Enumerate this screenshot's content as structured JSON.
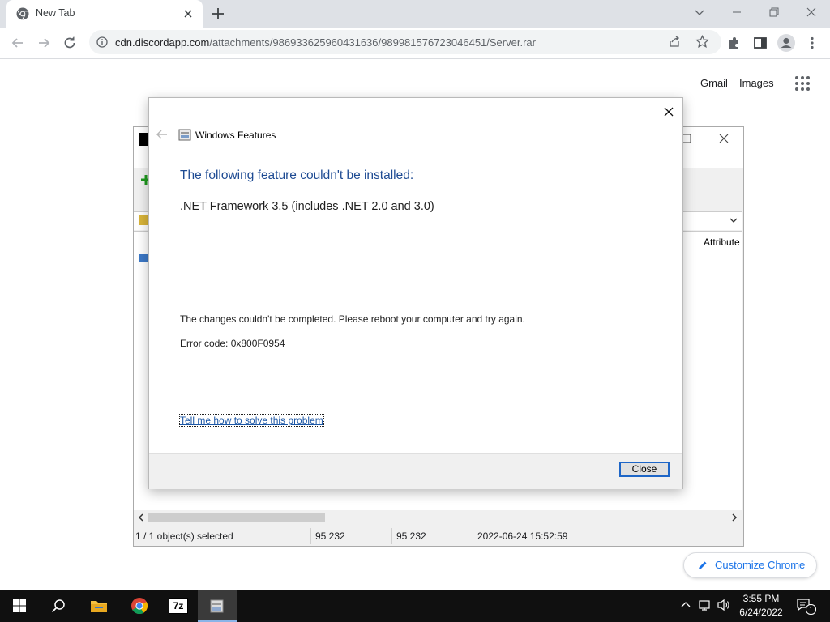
{
  "browser": {
    "tab_title": "New Tab",
    "url_host": "cdn.discordapp.com",
    "url_path": "/attachments/986933625960431636/989981576723046451/Server.rar"
  },
  "ntp": {
    "gmail": "Gmail",
    "images": "Images",
    "customize_chrome": "Customize Chrome"
  },
  "sevenzip": {
    "column_attributes": "Attribute",
    "status": {
      "selection": "1 / 1 object(s) selected",
      "size": "95 232",
      "packed_size": "95 232",
      "modified": "2022-06-24 15:52:59"
    }
  },
  "dialog": {
    "title": "Windows Features",
    "heading": "The following feature couldn't be installed:",
    "feature": ".NET Framework 3.5 (includes .NET 2.0 and 3.0)",
    "message": "The changes couldn't be completed. Please reboot your computer and try again.",
    "error_code": "Error code: 0x800F0954",
    "help_link": "Tell me how to solve this problem",
    "close_label": "Close"
  },
  "taskbar": {
    "time": "3:55 PM",
    "date": "6/24/2022",
    "notification_count": "1",
    "sevenzip_label": "7z"
  },
  "colors": {
    "dialog_heading": "#1e4b93",
    "link": "#1c57a6",
    "taskbar": "#101010",
    "button_focus": "#1e66c7"
  }
}
